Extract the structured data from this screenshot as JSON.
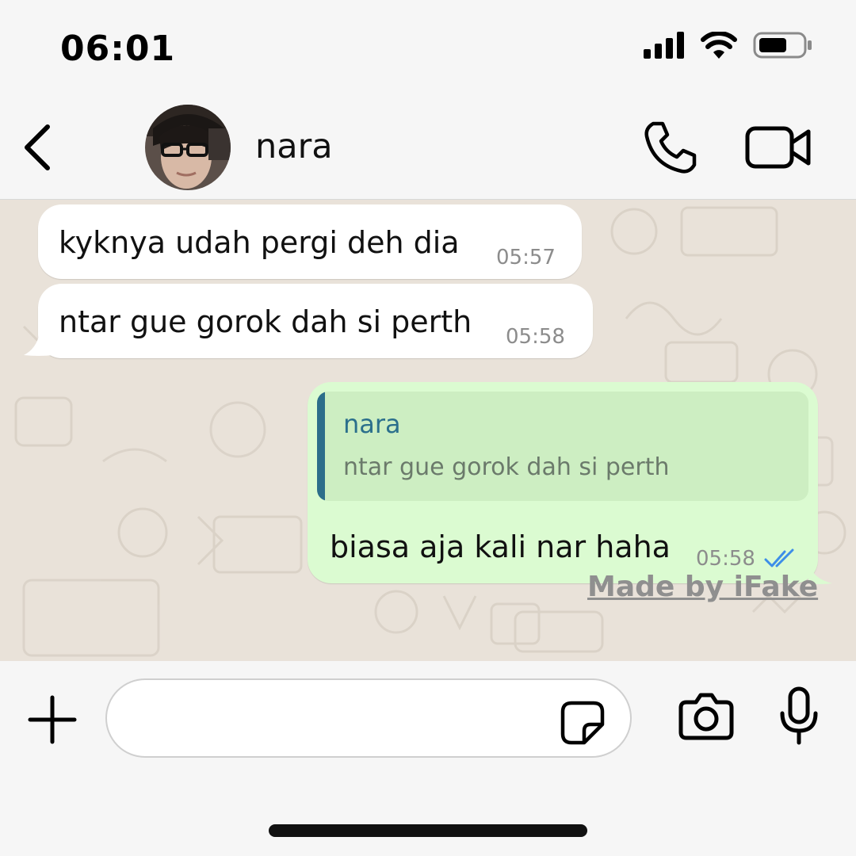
{
  "status_bar": {
    "time": "06:01",
    "icons": [
      "cellular-signal-icon",
      "wifi-icon",
      "battery-icon"
    ]
  },
  "header": {
    "back_icon": "chevron-left-icon",
    "contact_name": "nara",
    "call_icon": "phone-icon",
    "video_icon": "video-camera-icon"
  },
  "messages": [
    {
      "direction": "incoming",
      "text": "kyknya udah pergi deh dia",
      "time": "05:57"
    },
    {
      "direction": "incoming",
      "text": "ntar gue gorok dah si perth",
      "time": "05:58"
    },
    {
      "direction": "outgoing",
      "reply_to": {
        "name": "nara",
        "text": "ntar gue gorok dah si perth"
      },
      "text": "biasa aja kali nar haha",
      "time": "05:58",
      "status": "read"
    }
  ],
  "watermark": "Made by iFake",
  "input": {
    "placeholder": "",
    "icons": [
      "plus-icon",
      "sticker-icon",
      "camera-icon",
      "microphone-icon"
    ]
  },
  "colors": {
    "chat_background": "#e9e2d9",
    "incoming_bubble": "#ffffff",
    "outgoing_bubble": "#dbfbd1",
    "quote_accent": "#2b6f8c",
    "read_ticks": "#3d8ee8"
  }
}
